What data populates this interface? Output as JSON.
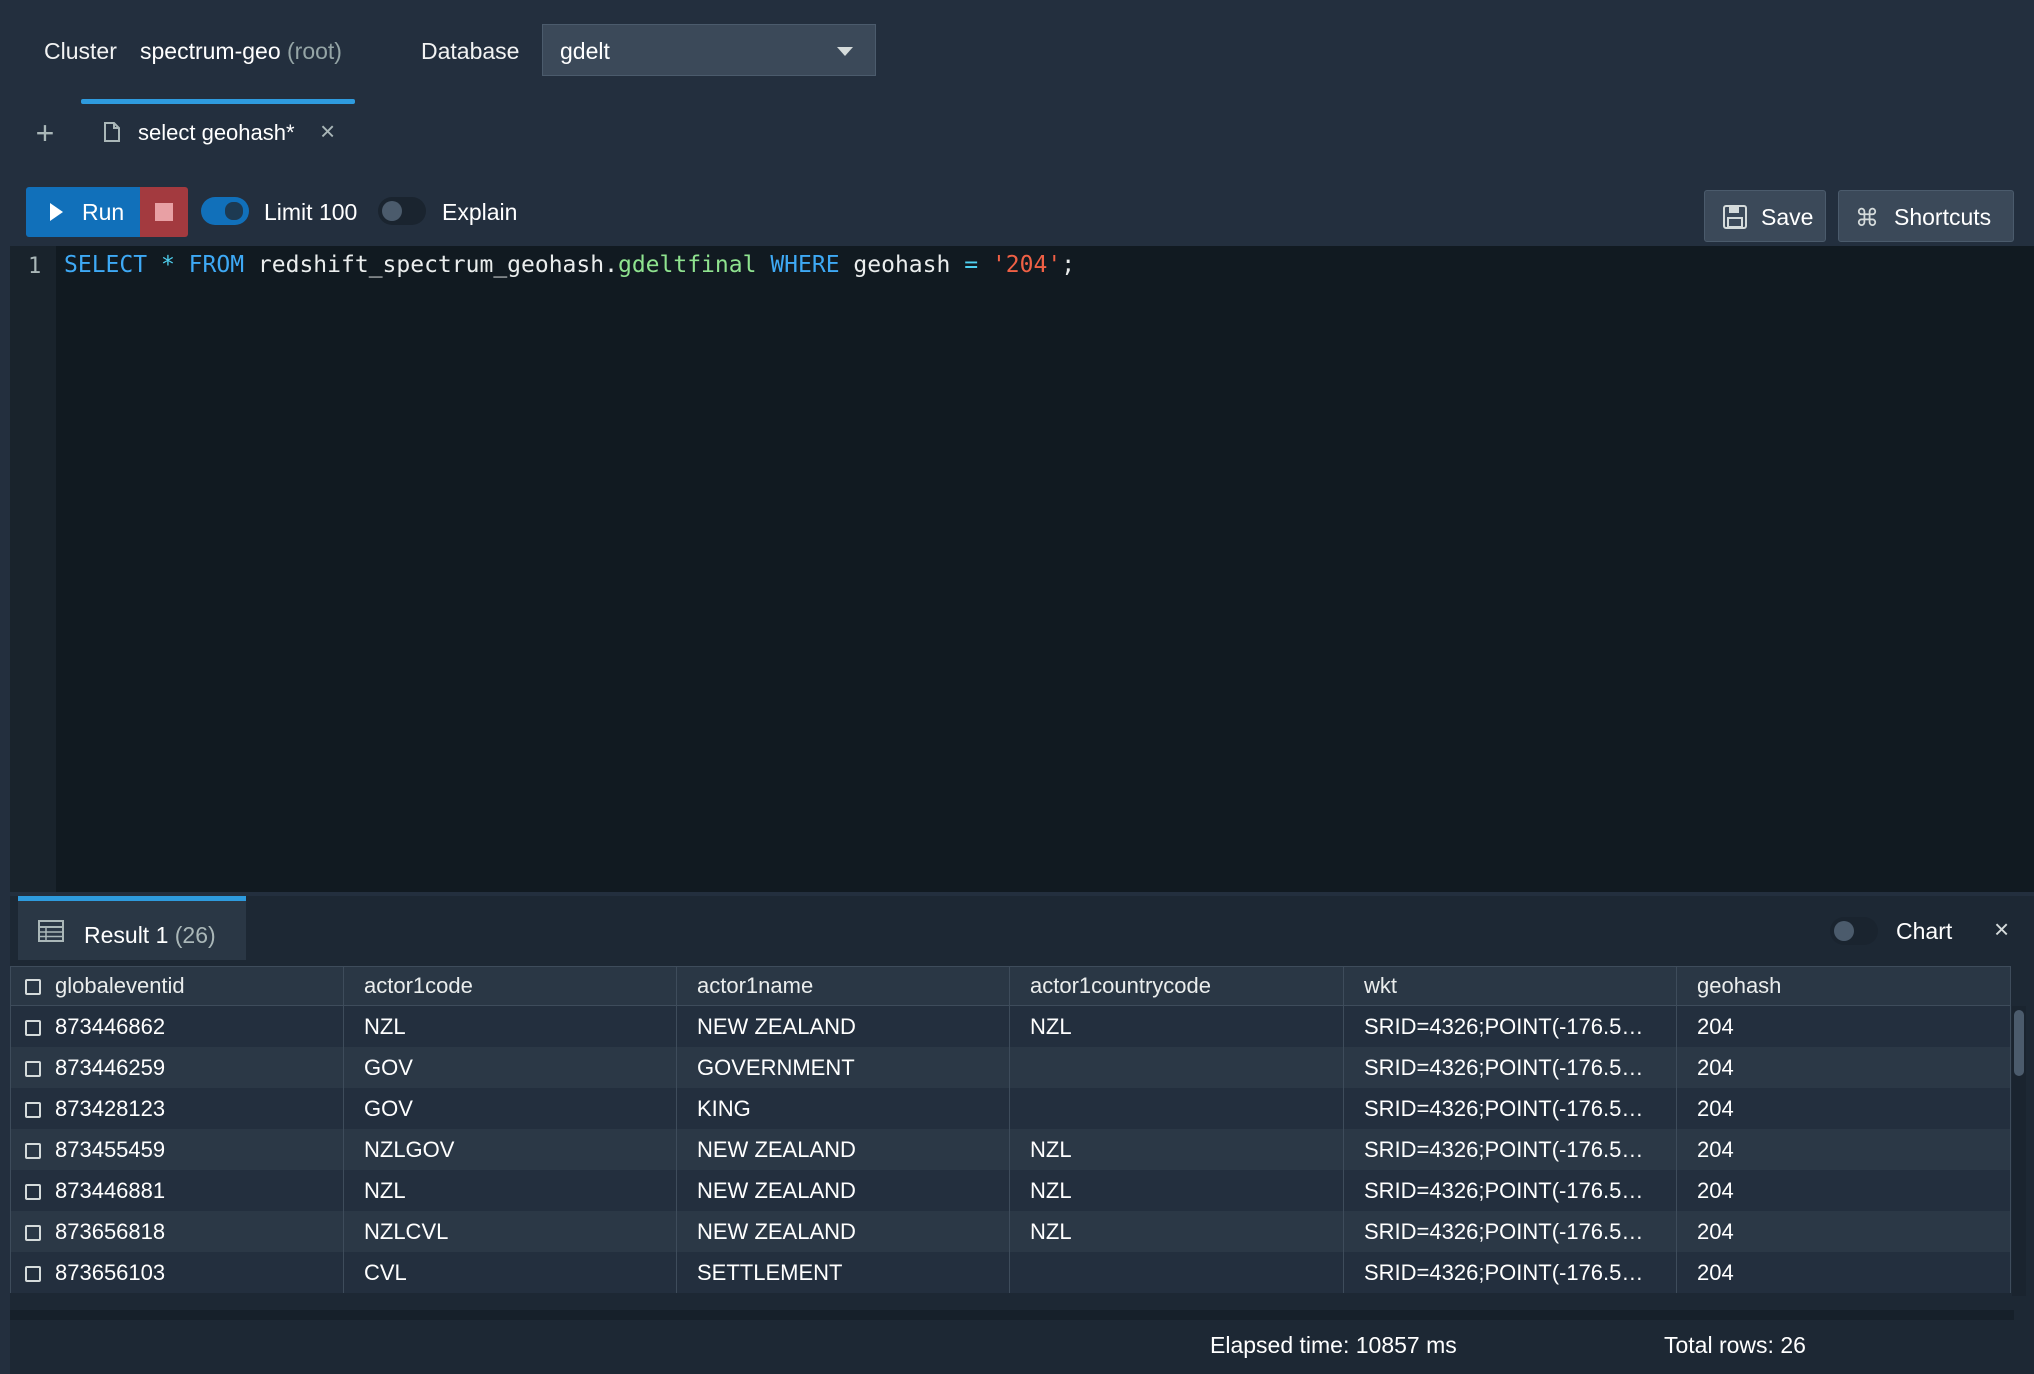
{
  "header": {
    "cluster_label": "Cluster",
    "cluster_name": "spectrum-geo",
    "cluster_user": "(root)",
    "database_label": "Database",
    "database_value": "gdelt"
  },
  "tabs": {
    "add_icon": "plus-icon",
    "active_tab_label": "select geohash*"
  },
  "toolbar": {
    "run_label": "Run",
    "limit_label": "Limit 100",
    "limit_on": true,
    "explain_label": "Explain",
    "explain_on": false,
    "save_label": "Save",
    "shortcuts_label": "Shortcuts"
  },
  "editor": {
    "line_number": "1",
    "tokens": {
      "select": "SELECT",
      "star": "*",
      "from": "FROM",
      "schema": "redshift_spectrum_geohash",
      "dot": ".",
      "table": "gdeltfinal",
      "where": "WHERE",
      "col": "geohash",
      "eq": "=",
      "str": "'204'",
      "semi": ";"
    }
  },
  "results": {
    "tab_label": "Result 1",
    "tab_count": "(26)",
    "chart_label": "Chart",
    "columns": [
      "globaleventid",
      "actor1code",
      "actor1name",
      "actor1countrycode",
      "wkt",
      "geohash"
    ],
    "rows": [
      [
        "873446862",
        "NZL",
        "NEW ZEALAND",
        "NZL",
        "SRID=4326;POINT(-176.5…",
        "204"
      ],
      [
        "873446259",
        "GOV",
        "GOVERNMENT",
        "",
        "SRID=4326;POINT(-176.5…",
        "204"
      ],
      [
        "873428123",
        "GOV",
        "KING",
        "",
        "SRID=4326;POINT(-176.5…",
        "204"
      ],
      [
        "873455459",
        "NZLGOV",
        "NEW ZEALAND",
        "NZL",
        "SRID=4326;POINT(-176.5…",
        "204"
      ],
      [
        "873446881",
        "NZL",
        "NEW ZEALAND",
        "NZL",
        "SRID=4326;POINT(-176.5…",
        "204"
      ],
      [
        "873656818",
        "NZLCVL",
        "NEW ZEALAND",
        "NZL",
        "SRID=4326;POINT(-176.5…",
        "204"
      ],
      [
        "873656103",
        "CVL",
        "SETTLEMENT",
        "",
        "SRID=4326;POINT(-176.5…",
        "204"
      ]
    ],
    "elapsed": "Elapsed time: 10857 ms",
    "total_rows": "Total rows: 26"
  },
  "colors": {
    "accent": "#2e9bde",
    "run": "#1170ba",
    "stop": "#a33a3f",
    "background": "#232f3e",
    "editor_bg": "#111a21"
  }
}
